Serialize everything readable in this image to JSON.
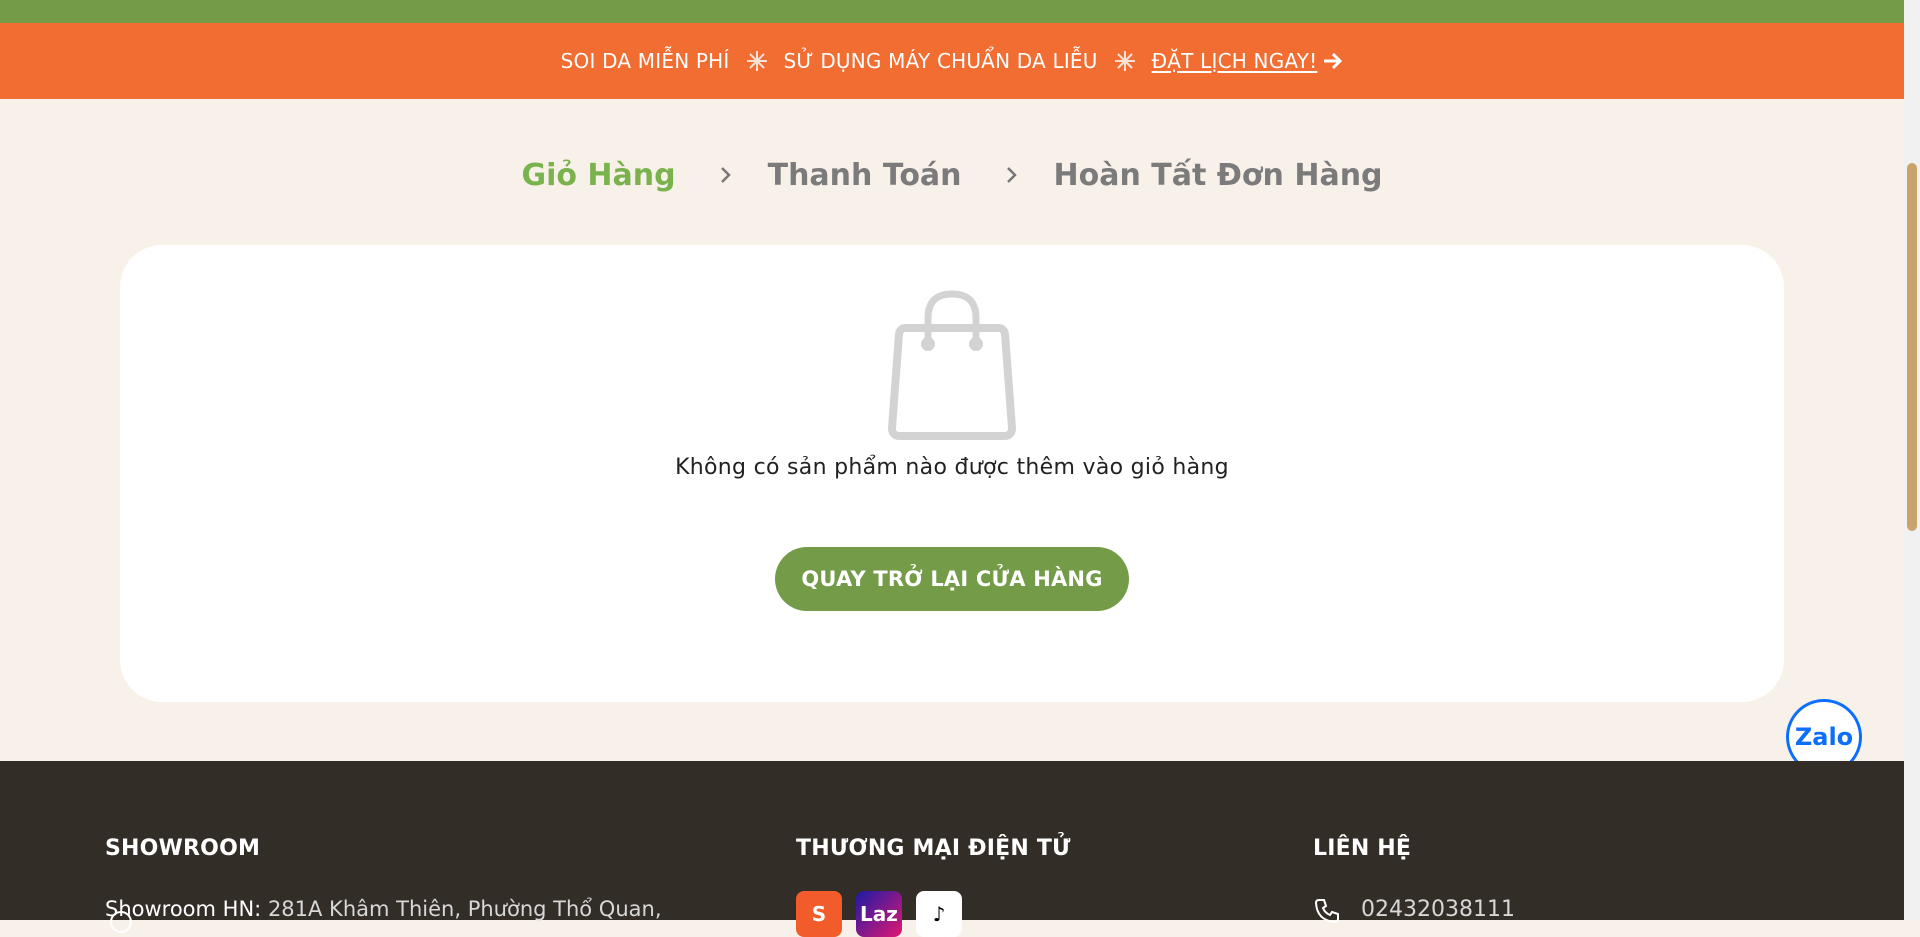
{
  "promo": {
    "item1": "SOI DA MIỄN PHÍ",
    "item2": "SỬ DỤNG MÁY CHUẨN DA LIỄU",
    "cta": "ĐẶT LỊCH NGAY!"
  },
  "steps": [
    "Giỏ Hàng",
    "Thanh Toán",
    "Hoàn Tất Đơn Hàng"
  ],
  "cart": {
    "empty_message": "Không có sản phẩm nào được thêm vào giỏ hàng",
    "back_button": "QUAY TRỞ LẠI CỬA HÀNG"
  },
  "zalo_label": "Zalo",
  "footer": {
    "showroom_title": "SHOWROOM",
    "showroom_label": "Showroom HN:",
    "showroom_address": "281A Khâm Thiên, Phường Thổ Quan,",
    "ecommerce_title": "THƯƠNG MẠI ĐIỆN TỬ",
    "ecommerce_logos": [
      "S",
      "Laz",
      "♪"
    ],
    "contact_title": "LIÊN HỆ",
    "phone": "02432038111"
  },
  "colors": {
    "green": "#739b48",
    "orange": "#f26d31",
    "active_step": "#7ab24d",
    "footer_bg": "#332d28"
  },
  "icons": [
    "sparkle-icon",
    "arrow-right-icon",
    "chevron-right-icon",
    "shopping-bag-icon",
    "location-icon",
    "phone-icon",
    "zalo-icon"
  ]
}
